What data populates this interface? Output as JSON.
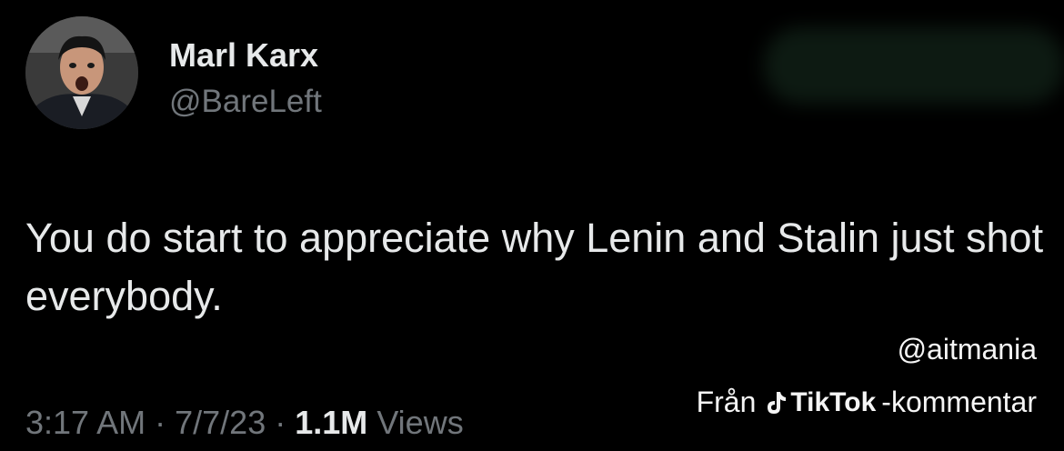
{
  "tweet": {
    "author": {
      "display_name": "Marl Karx",
      "handle": "@BareLeft"
    },
    "text": "You do start to appreciate why Lenin and Stalin just shot everybody.",
    "meta": {
      "time": "3:17 AM",
      "separator": "·",
      "date": "7/7/23",
      "views_count": "1.1M",
      "views_label": "Views"
    }
  },
  "watermark": {
    "user": "@aitmania",
    "prefix": "Från",
    "brand": "TikTok",
    "suffix": "-kommentar"
  }
}
